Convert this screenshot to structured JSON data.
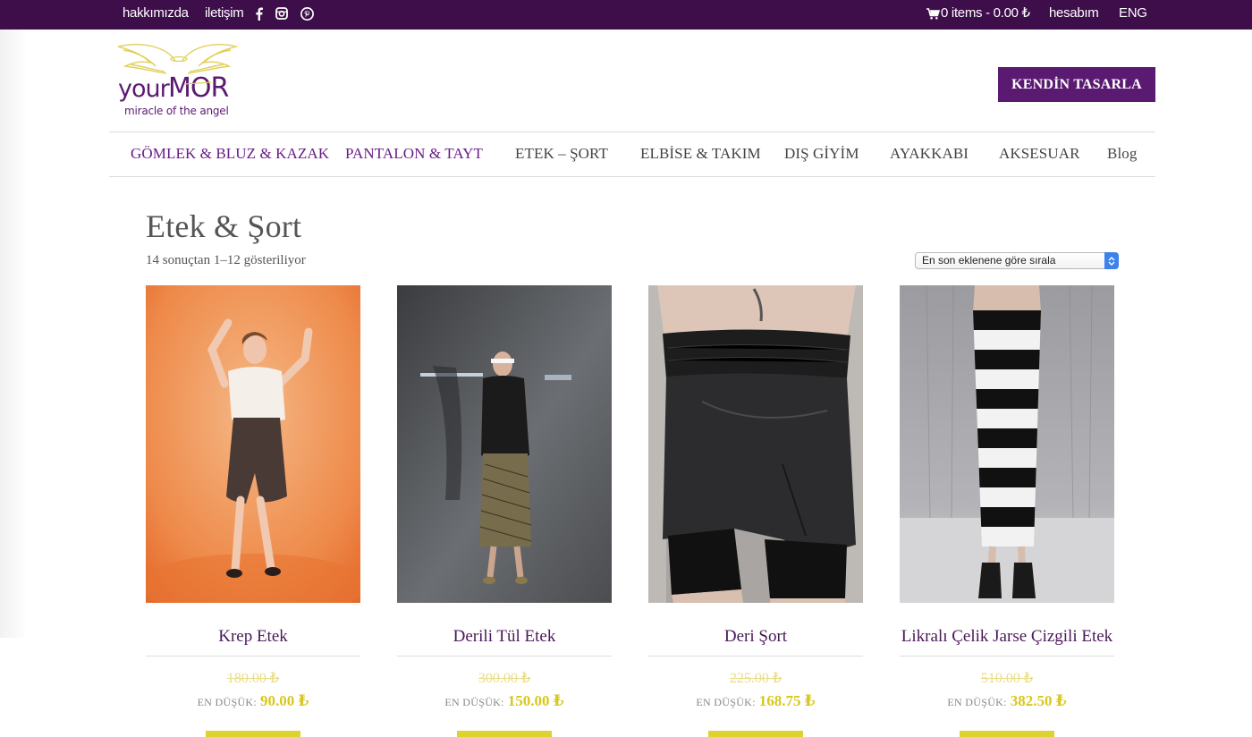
{
  "topbar": {
    "about": "hakkımızda",
    "contact": "iletişim",
    "cart": "0 items - 0.00 ₺",
    "account": "hesabım",
    "lang": "ENG",
    "social_icons": [
      "facebook-icon",
      "instagram-icon",
      "pinterest-icon"
    ]
  },
  "header": {
    "logo_text": "yourMOR",
    "logo_tagline": "miracle of the angel",
    "design_button": "KENDİN TASARLA"
  },
  "nav": {
    "items": [
      "GÖMLEK & BLUZ & KAZAK",
      "PANTALON & TAYT",
      "ETEK – ŞORT",
      "ELBİSE & TAKIM",
      "DIŞ GİYİM",
      "AYAKKABI",
      "AKSESUAR",
      "Blog"
    ]
  },
  "page": {
    "title": "Etek & Şort",
    "result_count": "14 sonuçtan 1–12 gösteriliyor",
    "sort_selected": "En son eklenene göre sırala"
  },
  "products": [
    {
      "name": "Krep Etek",
      "old_price": "180.00 ₺",
      "price_label": "EN DÜŞÜK:",
      "price": "90.00 ₺"
    },
    {
      "name": "Derili Tül Etek",
      "old_price": "300.00 ₺",
      "price_label": "EN DÜŞÜK:",
      "price": "150.00 ₺"
    },
    {
      "name": "Deri Şort",
      "old_price": "225.00 ₺",
      "price_label": "EN DÜŞÜK:",
      "price": "168.75 ₺"
    },
    {
      "name": "Likralı Çelik Jarse Çizgili Etek",
      "old_price": "510.00 ₺",
      "price_label": "EN DÜŞÜK:",
      "price": "382.50 ₺"
    }
  ],
  "colors": {
    "topbar": "#3d0e4a",
    "brand_purple": "#5b1a72",
    "nav_accent": "#6a1b86",
    "price_yellow": "#d9c71f",
    "logo_gold": "#e0cf5a"
  }
}
